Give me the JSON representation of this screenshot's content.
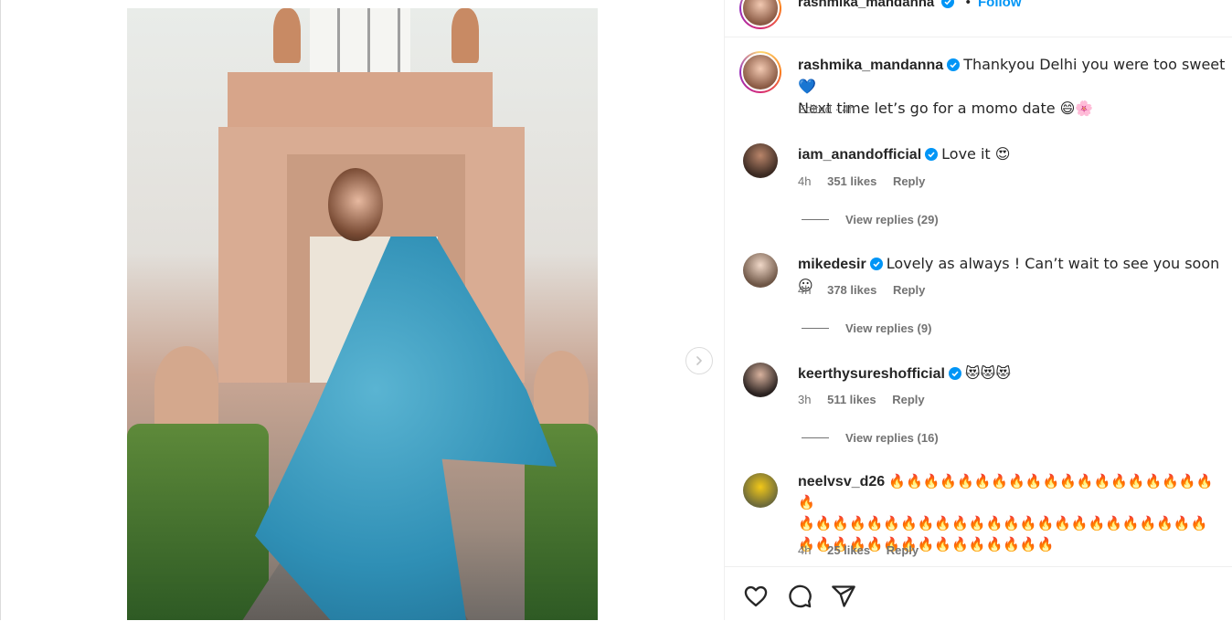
{
  "post_header": {
    "username": "rashmika_mandanna",
    "separator": "•",
    "follow_label": "Follow"
  },
  "caption": {
    "username": "rashmika_mandanna",
    "text_line1": "Thankyou Delhi you were too sweet 💙",
    "text_line2": "Next time let’s go for a momo date 😄🌸",
    "meta": "Edited · 4h"
  },
  "comments": [
    {
      "username": "iam_anandofficial",
      "verified": true,
      "text": "Love it 😍",
      "time": "4h",
      "likes": "351 likes",
      "reply": "Reply",
      "view_replies": "View replies (29)"
    },
    {
      "username": "mikedesir",
      "verified": true,
      "text": "Lovely as always ! Can’t wait to see you soon ☺",
      "time": "4h",
      "likes": "378 likes",
      "reply": "Reply",
      "view_replies": "View replies (9)"
    },
    {
      "username": "keerthysureshofficial",
      "verified": true,
      "text": "😻😻😻",
      "time": "3h",
      "likes": "511 likes",
      "reply": "Reply",
      "view_replies": "View replies (16)"
    },
    {
      "username": "neelvsv_d26",
      "verified": false,
      "text_line1": "🔥🔥🔥🔥🔥🔥🔥🔥🔥🔥🔥🔥🔥🔥🔥🔥🔥🔥🔥🔥",
      "text_line2": "🔥🔥🔥🔥🔥🔥🔥🔥🔥🔥🔥🔥🔥🔥🔥🔥🔥🔥🔥🔥🔥🔥🔥🔥",
      "text_line3": "🔥🔥🔥🔥🔥🔥🔥🔥🔥🔥🔥🔥🔥🔥🔥",
      "time": "4h",
      "likes": "25 likes",
      "reply": "Reply"
    }
  ],
  "icons": {
    "like": "heart-icon",
    "comment": "comment-icon",
    "share": "share-icon",
    "next": "chevron-right-icon",
    "verified": "verified-badge-icon"
  },
  "colors": {
    "verified_blue": "#0095f6",
    "follow_blue": "#0095f6",
    "meta_gray": "#737373",
    "border": "#efefef"
  }
}
